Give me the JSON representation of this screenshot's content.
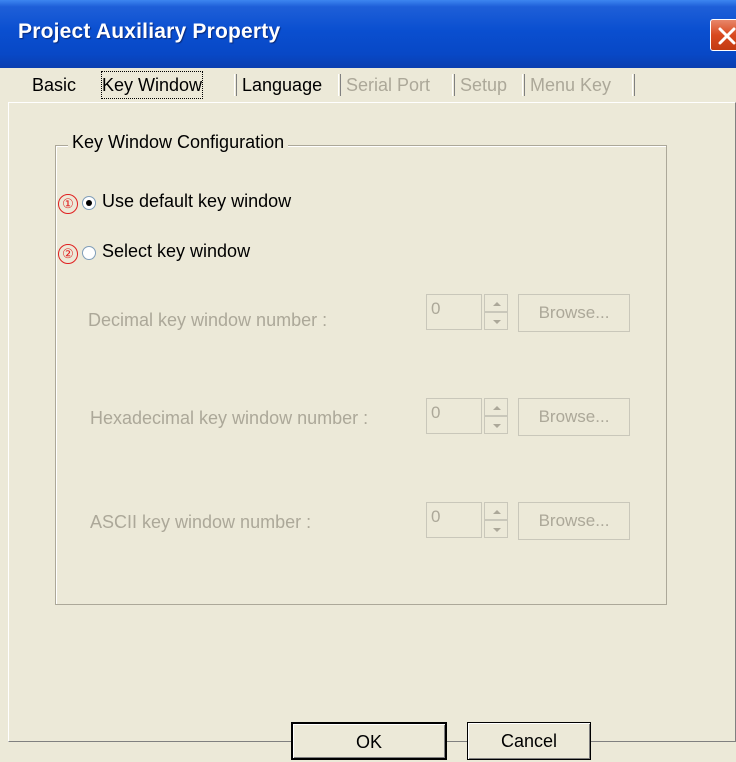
{
  "window": {
    "title": "Project Auxiliary Property"
  },
  "tabs": [
    {
      "label": "Basic",
      "state": "enabled"
    },
    {
      "label": "Key Window",
      "state": "selected"
    },
    {
      "label": "Language",
      "state": "enabled"
    },
    {
      "label": "Serial Port",
      "state": "disabled"
    },
    {
      "label": "Setup",
      "state": "disabled"
    },
    {
      "label": "Menu Key",
      "state": "disabled"
    }
  ],
  "group": {
    "label": "Key Window Configuration"
  },
  "radios": [
    {
      "badge": "①",
      "label": "Use default key window",
      "checked": true
    },
    {
      "badge": "②",
      "label": "Select key window",
      "checked": false
    }
  ],
  "fields": [
    {
      "label": "Decimal key window number :",
      "value": "0",
      "button": "Browse..."
    },
    {
      "label": "Hexadecimal key window number :",
      "value": "0",
      "button": "Browse..."
    },
    {
      "label": "ASCII key window number :",
      "value": "0",
      "button": "Browse..."
    }
  ],
  "buttons": {
    "ok": "OK",
    "cancel": "Cancel"
  },
  "colors": {
    "title_bar": "#0a4fd0",
    "close_button": "#d9491f",
    "face": "#ece9d8",
    "disabled_text": "#aca899",
    "badge": "#e02020"
  }
}
